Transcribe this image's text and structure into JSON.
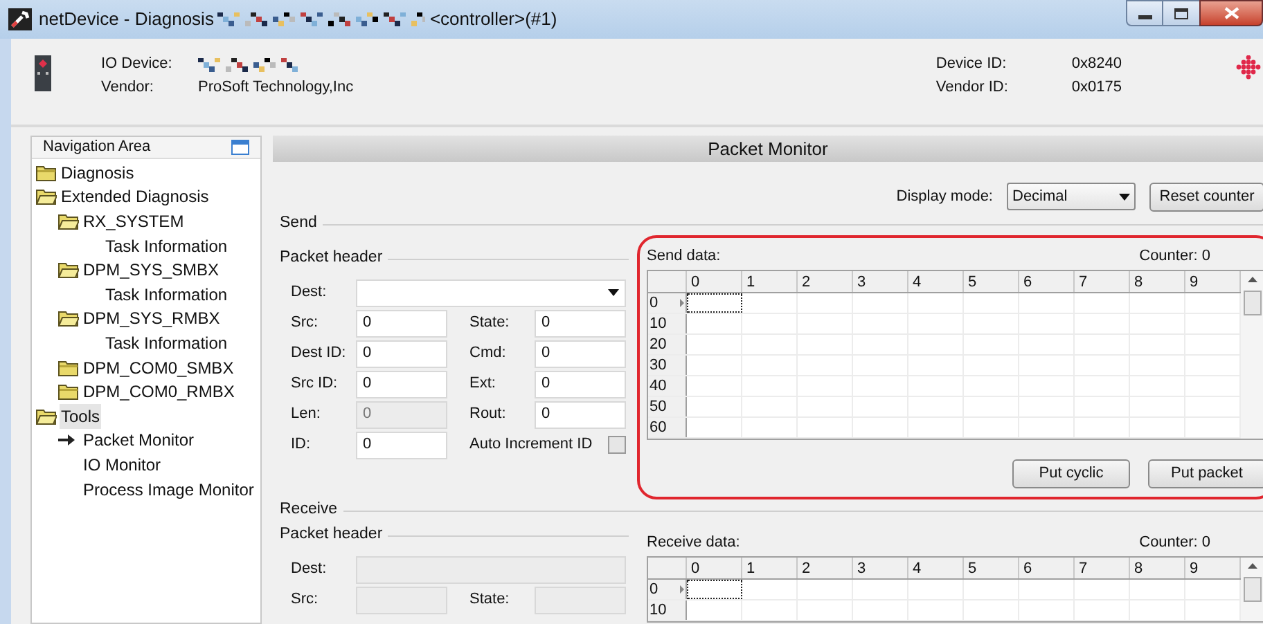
{
  "window": {
    "title": "netDevice - Diagnosis",
    "title_suffix": "<controller>(#1)"
  },
  "device": {
    "io_device_label": "IO Device:",
    "vendor_label": "Vendor:",
    "vendor": "ProSoft Technology,Inc",
    "device_id_label": "Device ID:",
    "device_id": "0x8240",
    "vendor_id_label": "Vendor ID:",
    "vendor_id": "0x0175"
  },
  "navigation": {
    "title": "Navigation Area",
    "items": [
      {
        "label": "Diagnosis",
        "kind": "folder",
        "expanded": false,
        "selected": false
      },
      {
        "label": "Extended Diagnosis",
        "kind": "folder",
        "expanded": true,
        "selected": false,
        "children": [
          {
            "label": "RX_SYSTEM",
            "kind": "folder",
            "expanded": true,
            "selected": false,
            "children": [
              {
                "label": "Task Information",
                "kind": "leaf",
                "active": false,
                "selected": false
              }
            ]
          },
          {
            "label": "DPM_SYS_SMBX",
            "kind": "folder",
            "expanded": true,
            "selected": false,
            "children": [
              {
                "label": "Task Information",
                "kind": "leaf",
                "active": false,
                "selected": false
              }
            ]
          },
          {
            "label": "DPM_SYS_RMBX",
            "kind": "folder",
            "expanded": true,
            "selected": false,
            "children": [
              {
                "label": "Task Information",
                "kind": "leaf",
                "active": false,
                "selected": false
              }
            ]
          },
          {
            "label": "DPM_COM0_SMBX",
            "kind": "folder",
            "expanded": false,
            "selected": false
          },
          {
            "label": "DPM_COM0_RMBX",
            "kind": "folder",
            "expanded": false,
            "selected": false
          }
        ]
      },
      {
        "label": "Tools",
        "kind": "folder",
        "expanded": true,
        "selected": true,
        "children": [
          {
            "label": "Packet Monitor",
            "kind": "leaf",
            "active": true,
            "selected": false
          },
          {
            "label": "IO Monitor",
            "kind": "leaf",
            "active": false,
            "selected": false
          },
          {
            "label": "Process Image Monitor",
            "kind": "leaf",
            "active": false,
            "selected": false
          }
        ]
      }
    ]
  },
  "panel": {
    "title": "Packet Monitor",
    "display_mode_label": "Display mode:",
    "display_mode": "Decimal",
    "reset_button": "Reset counter"
  },
  "send": {
    "title": "Send",
    "header_title": "Packet header",
    "dest": {
      "label": "Dest:",
      "disabled": false
    },
    "rows": [
      {
        "left": {
          "label": "Src:",
          "value": "0",
          "disabled": false
        },
        "right": {
          "label": "State:",
          "value": "0",
          "disabled": false
        }
      },
      {
        "left": {
          "label": "Dest ID:",
          "value": "0",
          "disabled": false
        },
        "right": {
          "label": "Cmd:",
          "value": "0",
          "disabled": false
        }
      },
      {
        "left": {
          "label": "Src ID:",
          "value": "0",
          "disabled": false
        },
        "right": {
          "label": "Ext:",
          "value": "0",
          "disabled": false
        }
      },
      {
        "left": {
          "label": "Len:",
          "value": "0",
          "disabled": true
        },
        "right": {
          "label": "Rout:",
          "value": "0",
          "disabled": false
        }
      },
      {
        "left": {
          "label": "ID:",
          "value": "0",
          "disabled": false
        },
        "right": {
          "label": "Auto Increment ID",
          "kind": "checkbox",
          "checked": false
        }
      }
    ],
    "data": {
      "title": "Send data:",
      "counter": "Counter: 0",
      "highlighted": true,
      "columns": [
        "0",
        "1",
        "2",
        "3",
        "4",
        "5",
        "6",
        "7",
        "8",
        "9"
      ],
      "rows": [
        "0",
        "10",
        "20",
        "30",
        "40",
        "50",
        "60"
      ],
      "buttons": [
        "Put cyclic",
        "Put packet"
      ]
    }
  },
  "receive": {
    "title": "Receive",
    "header_title": "Packet header",
    "dest": {
      "label": "Dest:",
      "disabled": true
    },
    "rows": [
      {
        "left": {
          "label": "Src:",
          "disabled": true
        },
        "right": {
          "label": "State:",
          "disabled": true
        }
      }
    ],
    "data": {
      "title": "Receive data:",
      "counter": "Counter: 0",
      "highlighted": false,
      "columns": [
        "0",
        "1",
        "2",
        "3",
        "4",
        "5",
        "6",
        "7",
        "8",
        "9"
      ],
      "rows": [
        "0",
        "10"
      ]
    }
  }
}
